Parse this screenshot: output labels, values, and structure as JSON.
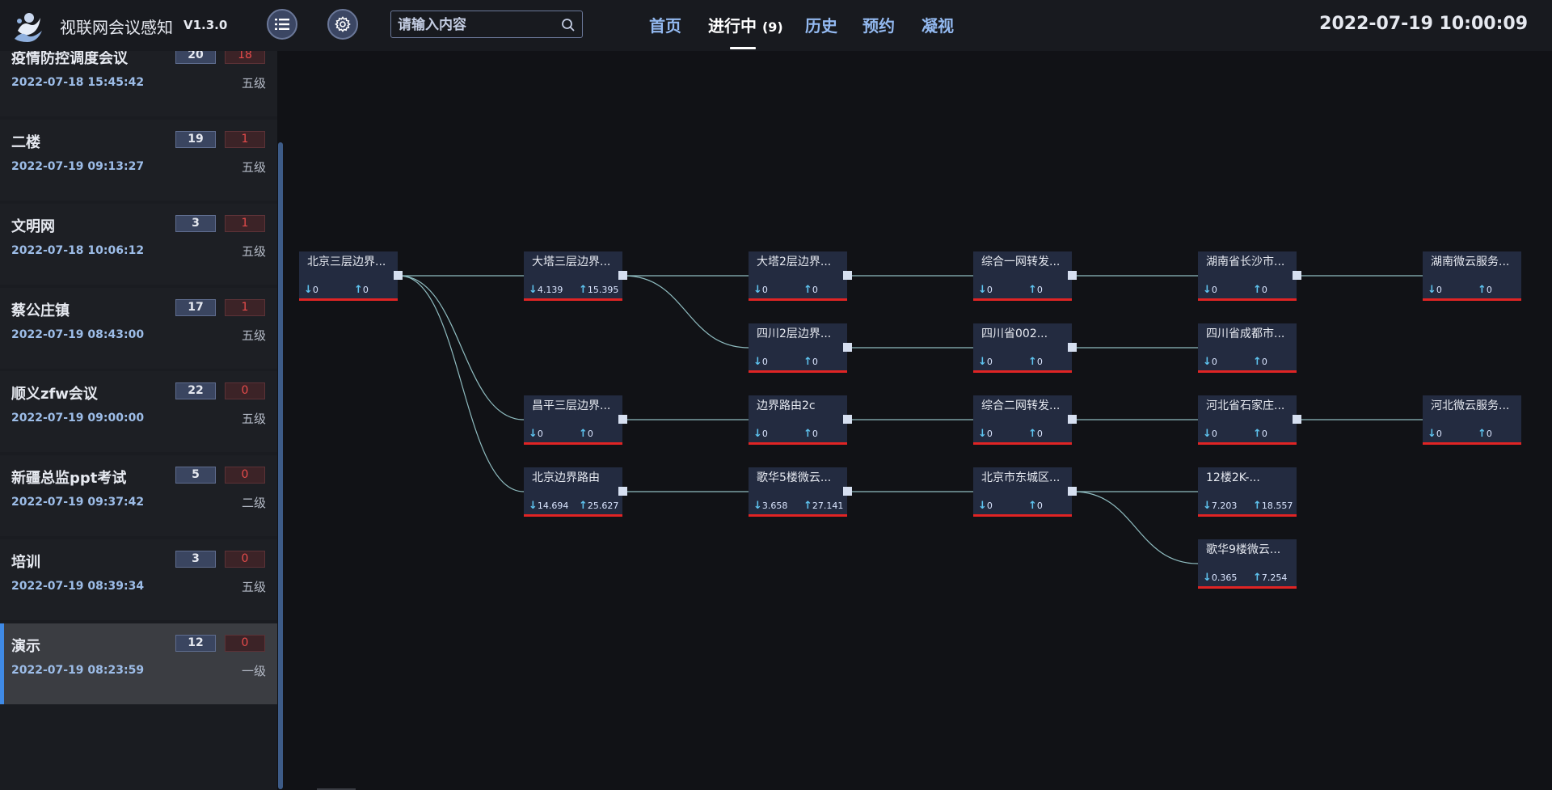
{
  "header": {
    "app_title": "视联网会议感知",
    "version": "V1.3.0",
    "search_placeholder": "请输入内容",
    "tabs": [
      {
        "label": "首页",
        "count": ""
      },
      {
        "label": "进行中",
        "count": "(9)"
      },
      {
        "label": "历史",
        "count": ""
      },
      {
        "label": "预约",
        "count": ""
      },
      {
        "label": "凝视",
        "count": ""
      }
    ],
    "active_tab": "进行中",
    "datetime": "2022-07-19 10:00:09"
  },
  "sidebar": {
    "meetings": [
      {
        "name": "疫情防控调度会议",
        "time": "2022-07-18 15:45:42",
        "count": "20",
        "alert": "18",
        "level": "五级"
      },
      {
        "name": "二楼",
        "time": "2022-07-19 09:13:27",
        "count": "19",
        "alert": "1",
        "level": "五级"
      },
      {
        "name": "文明网",
        "time": "2022-07-18 10:06:12",
        "count": "3",
        "alert": "1",
        "level": "五级"
      },
      {
        "name": "蔡公庄镇",
        "time": "2022-07-19 08:43:00",
        "count": "17",
        "alert": "1",
        "level": "五级"
      },
      {
        "name": "顺义zfw会议",
        "time": "2022-07-19 09:00:00",
        "count": "22",
        "alert": "0",
        "level": "五级"
      },
      {
        "name": "新疆总监ppt考试",
        "time": "2022-07-19 09:37:42",
        "count": "5",
        "alert": "0",
        "level": "二级"
      },
      {
        "name": "培训",
        "time": "2022-07-19 08:39:34",
        "count": "3",
        "alert": "0",
        "level": "五级"
      },
      {
        "name": "演示",
        "time": "2022-07-19 08:23:59",
        "count": "12",
        "alert": "0",
        "level": "一级",
        "selected": true
      }
    ]
  },
  "topology": {
    "colors": {
      "node_bg": "#232b40",
      "node_border": "#e02424",
      "link": "#8fbcc0",
      "arrow": "#5ec4f0"
    },
    "nodes": [
      {
        "id": "n1",
        "name": "北京三层边界...",
        "down": "0",
        "up": "0",
        "port": true
      },
      {
        "id": "n2",
        "name": "大塔三层边界...",
        "down": "4.139",
        "up": "15.395",
        "port": true
      },
      {
        "id": "n3",
        "name": "大塔2层边界...",
        "down": "0",
        "up": "0",
        "port": true
      },
      {
        "id": "n4",
        "name": "综合一网转发...",
        "down": "0",
        "up": "0",
        "port": true
      },
      {
        "id": "n5",
        "name": "湖南省长沙市...",
        "down": "0",
        "up": "0",
        "port": true
      },
      {
        "id": "n6",
        "name": "湖南微云服务...",
        "down": "0",
        "up": "0",
        "port": false
      },
      {
        "id": "n7",
        "name": "四川2层边界...",
        "down": "0",
        "up": "0",
        "port": true
      },
      {
        "id": "n8",
        "name": "四川省002...",
        "down": "0",
        "up": "0",
        "port": true
      },
      {
        "id": "n9",
        "name": "四川省成都市...",
        "down": "0",
        "up": "0",
        "port": false
      },
      {
        "id": "n10",
        "name": "昌平三层边界...",
        "down": "0",
        "up": "0",
        "port": true
      },
      {
        "id": "n11",
        "name": "边界路由2c",
        "down": "0",
        "up": "0",
        "port": true
      },
      {
        "id": "n12",
        "name": "综合二网转发...",
        "down": "0",
        "up": "0",
        "port": true
      },
      {
        "id": "n13",
        "name": "河北省石家庄...",
        "down": "0",
        "up": "0",
        "port": true
      },
      {
        "id": "n14",
        "name": "河北微云服务...",
        "down": "0",
        "up": "0",
        "port": false
      },
      {
        "id": "n15",
        "name": "北京边界路由",
        "down": "14.694",
        "up": "25.627",
        "port": true
      },
      {
        "id": "n16",
        "name": "歌华5楼微云...",
        "down": "3.658",
        "up": "27.141",
        "port": true
      },
      {
        "id": "n17",
        "name": "北京市东城区...",
        "down": "0",
        "up": "0",
        "port": true
      },
      {
        "id": "n18",
        "name": "12楼2K-...",
        "down": "7.203",
        "up": "18.557",
        "port": false
      },
      {
        "id": "n19",
        "name": "歌华9楼微云...",
        "down": "0.365",
        "up": "7.254",
        "port": false
      }
    ],
    "links": [
      [
        "n1",
        "n2"
      ],
      [
        "n1",
        "n10"
      ],
      [
        "n1",
        "n15"
      ],
      [
        "n2",
        "n3"
      ],
      [
        "n2",
        "n7"
      ],
      [
        "n3",
        "n4"
      ],
      [
        "n4",
        "n5"
      ],
      [
        "n5",
        "n6"
      ],
      [
        "n7",
        "n8"
      ],
      [
        "n8",
        "n9"
      ],
      [
        "n10",
        "n11"
      ],
      [
        "n11",
        "n12"
      ],
      [
        "n12",
        "n13"
      ],
      [
        "n13",
        "n14"
      ],
      [
        "n15",
        "n16"
      ],
      [
        "n16",
        "n17"
      ],
      [
        "n17",
        "n18"
      ],
      [
        "n17",
        "n19"
      ]
    ]
  }
}
